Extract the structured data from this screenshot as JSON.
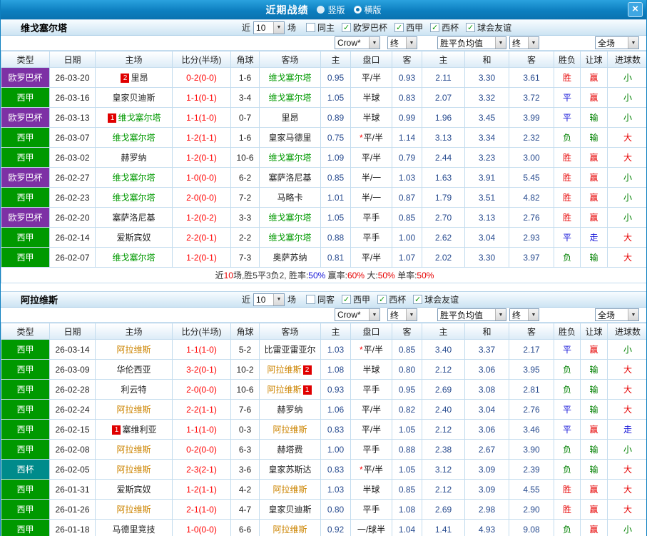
{
  "titlebar": {
    "title": "近期战绩",
    "vertical": "竖版",
    "horizontal": "横版",
    "close": "×"
  },
  "columns": [
    "类型",
    "日期",
    "主场",
    "比分(半场)",
    "角球",
    "客场",
    "主",
    "盘口",
    "客",
    "主",
    "和",
    "客",
    "胜负",
    "让球",
    "进球数"
  ],
  "colors": {
    "titlebar_blue": "#0d7fc0",
    "type_purple": "#7d31a5",
    "type_green": "#009900",
    "type_teal": "#008b8b",
    "focal_green": "#009900",
    "focal_orange": "#cc8400",
    "score_red": "#ff0000",
    "odds_blue": "#274b8f",
    "win_red": "#e60000",
    "draw_blue": "#1414d8",
    "lose_green": "#008000",
    "badge_red": "#e00000",
    "check_green": "#0a9a0a",
    "grid_border": "#c3dcee"
  },
  "sections": [
    {
      "team": "维戈塞尔塔",
      "team_color": "green",
      "near": "近",
      "count": "10",
      "games": "场",
      "same": {
        "label": "同主",
        "checked": false
      },
      "leagues": [
        {
          "label": "欧罗巴杯",
          "checked": true
        },
        {
          "label": "西甲",
          "checked": true
        },
        {
          "label": "西杯",
          "checked": true
        },
        {
          "label": "球会友谊",
          "checked": true
        }
      ],
      "filters": {
        "bookie": "Crow*",
        "final1": "终",
        "avg": "胜平负均值",
        "final2": "终",
        "scope": "全场"
      },
      "rows": [
        {
          "type": "欧罗巴杯",
          "tc": "purple",
          "date": "26-03-20",
          "home": "里昂",
          "hb": "2",
          "hbp": "before",
          "hf": false,
          "score": "0-2(0-0)",
          "corner": "1-6",
          "away": "维戈塞尔塔",
          "af": true,
          "o1": "0.95",
          "hc": "平/半",
          "o2": "0.93",
          "a1": "2.11",
          "a2": "3.30",
          "a3": "3.61",
          "r1": [
            "胜",
            "r"
          ],
          "r2": [
            "赢",
            "r"
          ],
          "r3": [
            "小",
            "g"
          ]
        },
        {
          "type": "西甲",
          "tc": "green",
          "date": "26-03-16",
          "home": "皇家贝迪斯",
          "hf": false,
          "score": "1-1(0-1)",
          "corner": "3-4",
          "away": "维戈塞尔塔",
          "af": true,
          "o1": "1.05",
          "hc": "半球",
          "o2": "0.83",
          "a1": "2.07",
          "a2": "3.32",
          "a3": "3.72",
          "r1": [
            "平",
            "b"
          ],
          "r2": [
            "赢",
            "r"
          ],
          "r3": [
            "小",
            "g"
          ]
        },
        {
          "type": "欧罗巴杯",
          "tc": "purple",
          "date": "26-03-13",
          "home": "维戈塞尔塔",
          "hb": "1",
          "hbp": "before",
          "hf": true,
          "score": "1-1(1-0)",
          "corner": "0-7",
          "away": "里昂",
          "af": false,
          "o1": "0.89",
          "hc": "半球",
          "o2": "0.99",
          "a1": "1.96",
          "a2": "3.45",
          "a3": "3.99",
          "r1": [
            "平",
            "b"
          ],
          "r2": [
            "输",
            "g"
          ],
          "r3": [
            "小",
            "g"
          ]
        },
        {
          "type": "西甲",
          "tc": "green",
          "date": "26-03-07",
          "home": "维戈塞尔塔",
          "hf": true,
          "score": "1-2(1-1)",
          "corner": "1-6",
          "away": "皇家马德里",
          "af": false,
          "o1": "0.75",
          "star": true,
          "hc": "平/半",
          "o2": "1.14",
          "a1": "3.13",
          "a2": "3.34",
          "a3": "2.32",
          "r1": [
            "负",
            "g"
          ],
          "r2": [
            "输",
            "g"
          ],
          "r3": [
            "大",
            "r"
          ]
        },
        {
          "type": "西甲",
          "tc": "green",
          "date": "26-03-02",
          "home": "赫罗纳",
          "hf": false,
          "score": "1-2(0-1)",
          "corner": "10-6",
          "away": "维戈塞尔塔",
          "af": true,
          "o1": "1.09",
          "hc": "平/半",
          "o2": "0.79",
          "a1": "2.44",
          "a2": "3.23",
          "a3": "3.00",
          "r1": [
            "胜",
            "r"
          ],
          "r2": [
            "赢",
            "r"
          ],
          "r3": [
            "大",
            "r"
          ]
        },
        {
          "type": "欧罗巴杯",
          "tc": "purple",
          "date": "26-02-27",
          "home": "维戈塞尔塔",
          "hf": true,
          "score": "1-0(0-0)",
          "corner": "6-2",
          "away": "塞萨洛尼基",
          "af": false,
          "o1": "0.85",
          "hc": "半/一",
          "o2": "1.03",
          "a1": "1.63",
          "a2": "3.91",
          "a3": "5.45",
          "r1": [
            "胜",
            "r"
          ],
          "r2": [
            "赢",
            "r"
          ],
          "r3": [
            "小",
            "g"
          ]
        },
        {
          "type": "西甲",
          "tc": "green",
          "date": "26-02-23",
          "home": "维戈塞尔塔",
          "hf": true,
          "score": "2-0(0-0)",
          "corner": "7-2",
          "away": "马略卡",
          "af": false,
          "o1": "1.01",
          "hc": "半/一",
          "o2": "0.87",
          "a1": "1.79",
          "a2": "3.51",
          "a3": "4.82",
          "r1": [
            "胜",
            "r"
          ],
          "r2": [
            "赢",
            "r"
          ],
          "r3": [
            "小",
            "g"
          ]
        },
        {
          "type": "欧罗巴杯",
          "tc": "purple",
          "date": "26-02-20",
          "home": "塞萨洛尼基",
          "hf": false,
          "score": "1-2(0-2)",
          "corner": "3-3",
          "away": "维戈塞尔塔",
          "af": true,
          "o1": "1.05",
          "hc": "平手",
          "o2": "0.85",
          "a1": "2.70",
          "a2": "3.13",
          "a3": "2.76",
          "r1": [
            "胜",
            "r"
          ],
          "r2": [
            "赢",
            "r"
          ],
          "r3": [
            "小",
            "g"
          ]
        },
        {
          "type": "西甲",
          "tc": "green",
          "date": "26-02-14",
          "home": "爱斯宾奴",
          "hf": false,
          "score": "2-2(0-1)",
          "corner": "2-2",
          "away": "维戈塞尔塔",
          "af": true,
          "o1": "0.88",
          "hc": "平手",
          "o2": "1.00",
          "a1": "2.62",
          "a2": "3.04",
          "a3": "2.93",
          "r1": [
            "平",
            "b"
          ],
          "r2": [
            "走",
            "b"
          ],
          "r3": [
            "大",
            "r"
          ]
        },
        {
          "type": "西甲",
          "tc": "green",
          "date": "26-02-07",
          "home": "维戈塞尔塔",
          "hf": true,
          "score": "1-2(0-1)",
          "corner": "7-3",
          "away": "奥萨苏纳",
          "af": false,
          "o1": "0.81",
          "hc": "平/半",
          "o2": "1.07",
          "a1": "2.02",
          "a2": "3.30",
          "a3": "3.97",
          "r1": [
            "负",
            "g"
          ],
          "r2": [
            "输",
            "g"
          ],
          "r3": [
            "大",
            "r"
          ]
        }
      ],
      "summary": [
        [
          "近",
          "k"
        ],
        [
          "10",
          "r"
        ],
        [
          "场,胜5平3负2, 胜率:",
          "k"
        ],
        [
          "50%",
          "b"
        ],
        [
          " 赢率:",
          "k"
        ],
        [
          "60%",
          "r"
        ],
        [
          " 大:",
          "k"
        ],
        [
          "50%",
          "r"
        ],
        [
          " 单率:",
          "k"
        ],
        [
          "50%",
          "r"
        ]
      ]
    },
    {
      "team": "阿拉维斯",
      "team_color": "orange",
      "near": "近",
      "count": "10",
      "games": "场",
      "same": {
        "label": "同客",
        "checked": false
      },
      "leagues": [
        {
          "label": "西甲",
          "checked": true
        },
        {
          "label": "西杯",
          "checked": true
        },
        {
          "label": "球会友谊",
          "checked": true
        }
      ],
      "filters": {
        "bookie": "Crow*",
        "final1": "终",
        "avg": "胜平负均值",
        "final2": "终",
        "scope": "全场"
      },
      "rows": [
        {
          "type": "西甲",
          "tc": "green",
          "date": "26-03-14",
          "home": "阿拉维斯",
          "hf": true,
          "score": "1-1(1-0)",
          "corner": "5-2",
          "away": "比雷亚雷亚尔",
          "af": false,
          "o1": "1.03",
          "star": true,
          "hc": "平/半",
          "o2": "0.85",
          "a1": "3.40",
          "a2": "3.37",
          "a3": "2.17",
          "r1": [
            "平",
            "b"
          ],
          "r2": [
            "赢",
            "r"
          ],
          "r3": [
            "小",
            "g"
          ]
        },
        {
          "type": "西甲",
          "tc": "green",
          "date": "26-03-09",
          "home": "华伦西亚",
          "hf": false,
          "score": "3-2(0-1)",
          "corner": "10-2",
          "away": "阿拉维斯",
          "ab": "2",
          "abp": "after",
          "af": true,
          "o1": "1.08",
          "hc": "半球",
          "o2": "0.80",
          "a1": "2.12",
          "a2": "3.06",
          "a3": "3.95",
          "r1": [
            "负",
            "g"
          ],
          "r2": [
            "输",
            "g"
          ],
          "r3": [
            "大",
            "r"
          ]
        },
        {
          "type": "西甲",
          "tc": "green",
          "date": "26-02-28",
          "home": "利云特",
          "hf": false,
          "score": "2-0(0-0)",
          "corner": "10-6",
          "away": "阿拉维斯",
          "ab": "1",
          "abp": "after",
          "af": true,
          "o1": "0.93",
          "hc": "平手",
          "o2": "0.95",
          "a1": "2.69",
          "a2": "3.08",
          "a3": "2.81",
          "r1": [
            "负",
            "g"
          ],
          "r2": [
            "输",
            "g"
          ],
          "r3": [
            "大",
            "r"
          ]
        },
        {
          "type": "西甲",
          "tc": "green",
          "date": "26-02-24",
          "home": "阿拉维斯",
          "hf": true,
          "score": "2-2(1-1)",
          "corner": "7-6",
          "away": "赫罗纳",
          "af": false,
          "o1": "1.06",
          "hc": "平/半",
          "o2": "0.82",
          "a1": "2.40",
          "a2": "3.04",
          "a3": "2.76",
          "r1": [
            "平",
            "b"
          ],
          "r2": [
            "输",
            "g"
          ],
          "r3": [
            "大",
            "r"
          ]
        },
        {
          "type": "西甲",
          "tc": "green",
          "date": "26-02-15",
          "home": "塞维利亚",
          "hb": "1",
          "hbp": "before",
          "hf": false,
          "score": "1-1(1-0)",
          "corner": "0-3",
          "away": "阿拉维斯",
          "af": true,
          "o1": "0.83",
          "hc": "平/半",
          "o2": "1.05",
          "a1": "2.12",
          "a2": "3.06",
          "a3": "3.46",
          "r1": [
            "平",
            "b"
          ],
          "r2": [
            "赢",
            "r"
          ],
          "r3": [
            "走",
            "b"
          ]
        },
        {
          "type": "西甲",
          "tc": "green",
          "date": "26-02-08",
          "home": "阿拉维斯",
          "hf": true,
          "score": "0-2(0-0)",
          "corner": "6-3",
          "away": "赫塔费",
          "af": false,
          "o1": "1.00",
          "hc": "平手",
          "o2": "0.88",
          "a1": "2.38",
          "a2": "2.67",
          "a3": "3.90",
          "r1": [
            "负",
            "g"
          ],
          "r2": [
            "输",
            "g"
          ],
          "r3": [
            "小",
            "g"
          ]
        },
        {
          "type": "西杯",
          "tc": "teal",
          "date": "26-02-05",
          "home": "阿拉维斯",
          "hf": true,
          "score": "2-3(2-1)",
          "corner": "3-6",
          "away": "皇家苏斯达",
          "af": false,
          "o1": "0.83",
          "star": true,
          "hc": "平/半",
          "o2": "1.05",
          "a1": "3.12",
          "a2": "3.09",
          "a3": "2.39",
          "r1": [
            "负",
            "g"
          ],
          "r2": [
            "输",
            "g"
          ],
          "r3": [
            "大",
            "r"
          ]
        },
        {
          "type": "西甲",
          "tc": "green",
          "date": "26-01-31",
          "home": "爱斯宾奴",
          "hf": false,
          "score": "1-2(1-1)",
          "corner": "4-2",
          "away": "阿拉维斯",
          "af": true,
          "o1": "1.03",
          "hc": "半球",
          "o2": "0.85",
          "a1": "2.12",
          "a2": "3.09",
          "a3": "4.55",
          "r1": [
            "胜",
            "r"
          ],
          "r2": [
            "赢",
            "r"
          ],
          "r3": [
            "大",
            "r"
          ]
        },
        {
          "type": "西甲",
          "tc": "green",
          "date": "26-01-26",
          "home": "阿拉维斯",
          "hf": true,
          "score": "2-1(1-0)",
          "corner": "4-7",
          "away": "皇家贝迪斯",
          "af": false,
          "o1": "0.80",
          "hc": "平手",
          "o2": "1.08",
          "a1": "2.69",
          "a2": "2.98",
          "a3": "2.90",
          "r1": [
            "胜",
            "r"
          ],
          "r2": [
            "赢",
            "r"
          ],
          "r3": [
            "大",
            "r"
          ]
        },
        {
          "type": "西甲",
          "tc": "green",
          "date": "26-01-18",
          "home": "马德里竞技",
          "hf": false,
          "score": "1-0(0-0)",
          "corner": "6-6",
          "away": "阿拉维斯",
          "af": true,
          "o1": "0.92",
          "hc": "一/球半",
          "o2": "1.04",
          "a1": "1.41",
          "a2": "4.93",
          "a3": "9.08",
          "r1": [
            "负",
            "g"
          ],
          "r2": [
            "赢",
            "r"
          ],
          "r3": [
            "小",
            "g"
          ]
        }
      ],
      "summary": null
    }
  ]
}
